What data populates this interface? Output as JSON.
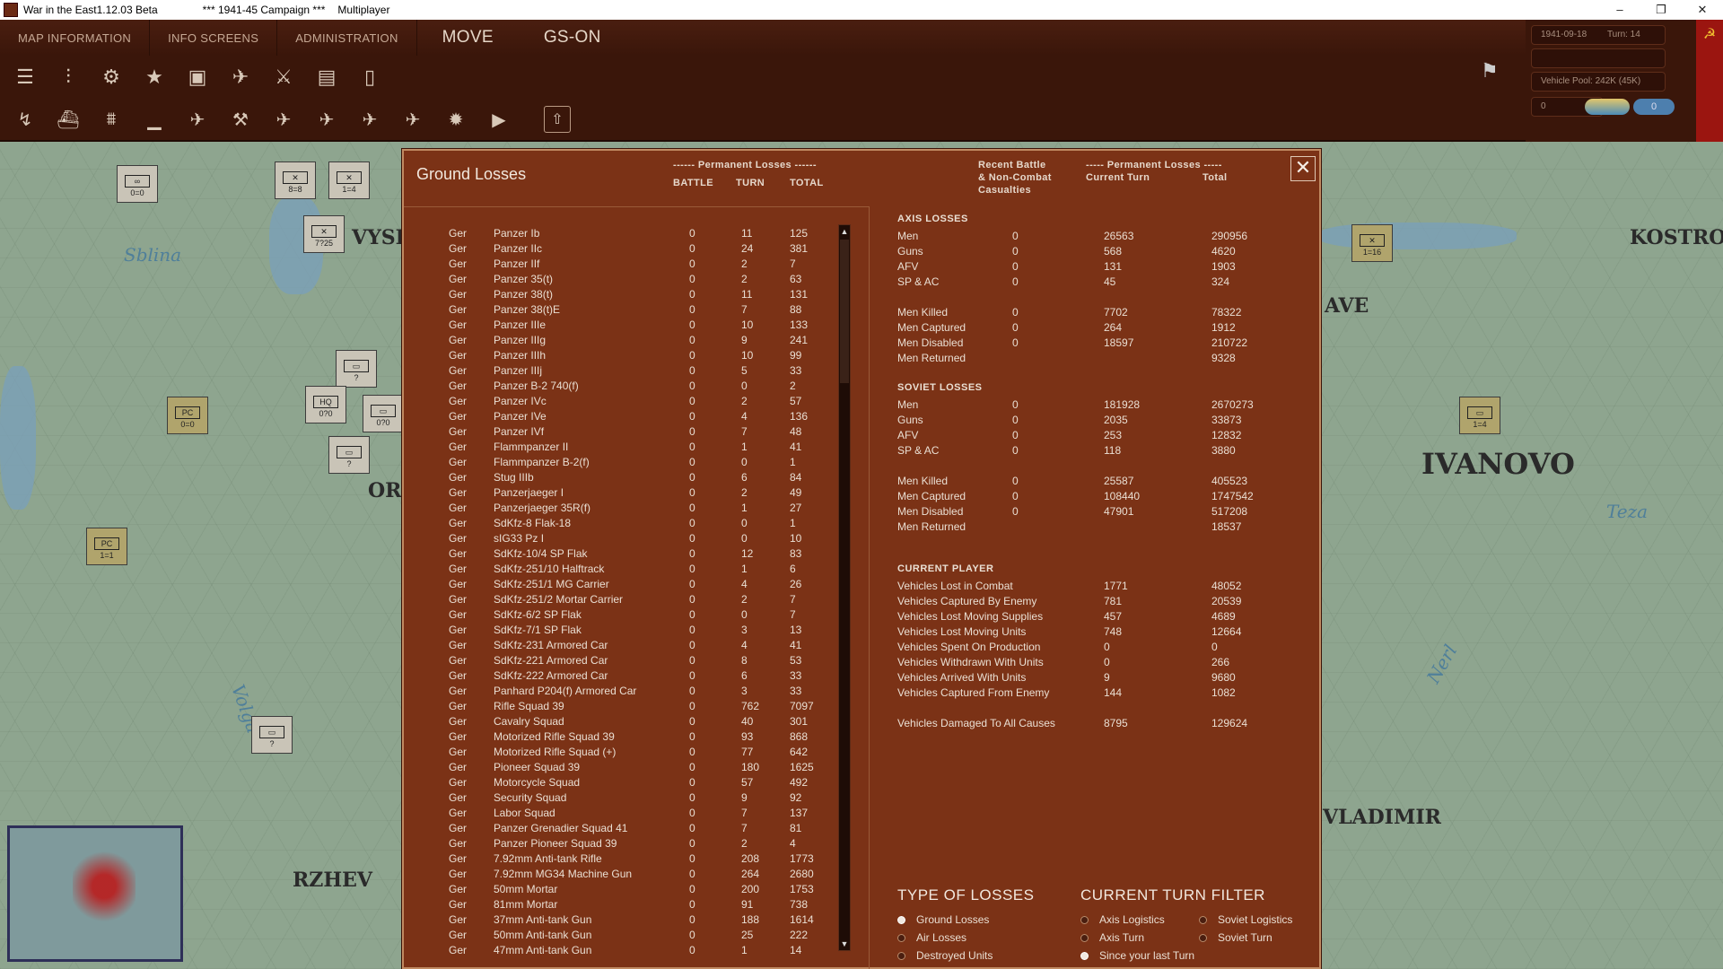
{
  "window": {
    "title": "War in the East1.12.03 Beta",
    "campaign": "***   1941-45 Campaign   ***",
    "mode": "Multiplayer",
    "controls": [
      "–",
      "❐",
      "✕"
    ]
  },
  "menu": {
    "tabs": [
      "MAP INFORMATION",
      "INFO SCREENS",
      "ADMINISTRATION"
    ],
    "phase": "MOVE",
    "gs": "GS-on"
  },
  "status": {
    "date": "1941-09-18",
    "turn": "Turn: 14",
    "vehicle_pool": "Vehicle Pool: 242K (45K)",
    "zero_value": "0",
    "pill_value": "0"
  },
  "map": {
    "labels": [
      "VYSH",
      "ORZ",
      "RZHEV",
      "KOSTRO",
      "IVANOVO",
      "VLADIMIR",
      "AVE"
    ],
    "rivers": [
      "Sblina",
      "Volga",
      "Teza",
      "Nerl"
    ],
    "units": [
      "0=0",
      "8=8",
      "1=4",
      "7?25",
      "?",
      "0?0",
      "0?0",
      "0=0",
      "?",
      "1=1",
      "?",
      "1=16",
      "1=4"
    ]
  },
  "dialog": {
    "title": "Ground Losses",
    "perm_header": "------ Permanent Losses ------",
    "col_battle": "BATTLE",
    "col_turn": "TURN",
    "col_total": "TOTAL",
    "recent_header": "Recent Battle\n& Non-Combat\nCasualties",
    "recent_l1": "Recent Battle",
    "recent_l2": "& Non-Combat",
    "recent_l3": "Casualties",
    "perm2_header": "----- Permanent Losses -----",
    "col_current": "Current Turn",
    "col_total2": "Total",
    "close": "✕"
  },
  "losses": [
    [
      "Ger",
      "Panzer Ib",
      "0",
      "11",
      "125"
    ],
    [
      "Ger",
      "Panzer IIc",
      "0",
      "24",
      "381"
    ],
    [
      "Ger",
      "Panzer IIf",
      "0",
      "2",
      "7"
    ],
    [
      "Ger",
      "Panzer 35(t)",
      "0",
      "2",
      "63"
    ],
    [
      "Ger",
      "Panzer 38(t)",
      "0",
      "11",
      "131"
    ],
    [
      "Ger",
      "Panzer 38(t)E",
      "0",
      "7",
      "88"
    ],
    [
      "Ger",
      "Panzer IIIe",
      "0",
      "10",
      "133"
    ],
    [
      "Ger",
      "Panzer IIIg",
      "0",
      "9",
      "241"
    ],
    [
      "Ger",
      "Panzer IIIh",
      "0",
      "10",
      "99"
    ],
    [
      "Ger",
      "Panzer IIIj",
      "0",
      "5",
      "33"
    ],
    [
      "Ger",
      "Panzer B-2 740(f)",
      "0",
      "0",
      "2"
    ],
    [
      "Ger",
      "Panzer IVc",
      "0",
      "2",
      "57"
    ],
    [
      "Ger",
      "Panzer IVe",
      "0",
      "4",
      "136"
    ],
    [
      "Ger",
      "Panzer IVf",
      "0",
      "7",
      "48"
    ],
    [
      "Ger",
      "Flammpanzer II",
      "0",
      "1",
      "41"
    ],
    [
      "Ger",
      "Flammpanzer B-2(f)",
      "0",
      "0",
      "1"
    ],
    [
      "Ger",
      "Stug IIIb",
      "0",
      "6",
      "84"
    ],
    [
      "Ger",
      "Panzerjaeger I",
      "0",
      "2",
      "49"
    ],
    [
      "Ger",
      "Panzerjaeger 35R(f)",
      "0",
      "1",
      "27"
    ],
    [
      "Ger",
      "SdKfz-8 Flak-18",
      "0",
      "0",
      "1"
    ],
    [
      "Ger",
      "sIG33 Pz I",
      "0",
      "0",
      "10"
    ],
    [
      "Ger",
      "SdKfz-10/4 SP Flak",
      "0",
      "12",
      "83"
    ],
    [
      "Ger",
      "SdKfz-251/10 Halftrack",
      "0",
      "1",
      "6"
    ],
    [
      "Ger",
      "SdKfz-251/1 MG Carrier",
      "0",
      "4",
      "26"
    ],
    [
      "Ger",
      "SdKfz-251/2 Mortar Carrier",
      "0",
      "2",
      "7"
    ],
    [
      "Ger",
      "SdKfz-6/2 SP Flak",
      "0",
      "0",
      "7"
    ],
    [
      "Ger",
      "SdKfz-7/1 SP Flak",
      "0",
      "3",
      "13"
    ],
    [
      "Ger",
      "SdKfz-231 Armored Car",
      "0",
      "4",
      "41"
    ],
    [
      "Ger",
      "SdKfz-221 Armored Car",
      "0",
      "8",
      "53"
    ],
    [
      "Ger",
      "SdKfz-222 Armored Car",
      "0",
      "6",
      "33"
    ],
    [
      "Ger",
      "Panhard P204(f) Armored Car",
      "0",
      "3",
      "33"
    ],
    [
      "Ger",
      "Rifle Squad 39",
      "0",
      "762",
      "7097"
    ],
    [
      "Ger",
      "Cavalry Squad",
      "0",
      "40",
      "301"
    ],
    [
      "Ger",
      "Motorized Rifle Squad 39",
      "0",
      "93",
      "868"
    ],
    [
      "Ger",
      "Motorized Rifle Squad (+)",
      "0",
      "77",
      "642"
    ],
    [
      "Ger",
      "Pioneer Squad 39",
      "0",
      "180",
      "1625"
    ],
    [
      "Ger",
      "Motorcycle Squad",
      "0",
      "57",
      "492"
    ],
    [
      "Ger",
      "Security Squad",
      "0",
      "9",
      "92"
    ],
    [
      "Ger",
      "Labor Squad",
      "0",
      "7",
      "137"
    ],
    [
      "Ger",
      "Panzer Grenadier Squad 41",
      "0",
      "7",
      "81"
    ],
    [
      "Ger",
      "Panzer Pioneer Squad 39",
      "0",
      "2",
      "4"
    ],
    [
      "Ger",
      "7.92mm Anti-tank Rifle",
      "0",
      "208",
      "1773"
    ],
    [
      "Ger",
      "7.92mm MG34 Machine Gun",
      "0",
      "264",
      "2680"
    ],
    [
      "Ger",
      "50mm Mortar",
      "0",
      "200",
      "1753"
    ],
    [
      "Ger",
      "81mm Mortar",
      "0",
      "91",
      "738"
    ],
    [
      "Ger",
      "37mm Anti-tank Gun",
      "0",
      "188",
      "1614"
    ],
    [
      "Ger",
      "50mm Anti-tank Gun",
      "0",
      "25",
      "222"
    ],
    [
      "Ger",
      "47mm Anti-tank Gun",
      "0",
      "1",
      "14"
    ]
  ],
  "axis": {
    "title": "AXIS LOSSES",
    "rows": [
      [
        "Men",
        "0",
        "26563",
        "290956"
      ],
      [
        "Guns",
        "0",
        "568",
        "4620"
      ],
      [
        "AFV",
        "0",
        "131",
        "1903"
      ],
      [
        "SP & AC",
        "0",
        "45",
        "324"
      ],
      [
        "Men Killed",
        "0",
        "7702",
        "78322"
      ],
      [
        "Men Captured",
        "0",
        "264",
        "1912"
      ],
      [
        "Men Disabled",
        "0",
        "18597",
        "210722"
      ],
      [
        "Men Returned",
        "",
        "",
        "9328"
      ]
    ]
  },
  "soviet": {
    "title": "SOVIET LOSSES",
    "rows": [
      [
        "Men",
        "0",
        "181928",
        "2670273"
      ],
      [
        "Guns",
        "0",
        "2035",
        "33873"
      ],
      [
        "AFV",
        "0",
        "253",
        "12832"
      ],
      [
        "SP & AC",
        "0",
        "118",
        "3880"
      ],
      [
        "Men Killed",
        "0",
        "25587",
        "405523"
      ],
      [
        "Men Captured",
        "0",
        "108440",
        "1747542"
      ],
      [
        "Men Disabled",
        "0",
        "47901",
        "517208"
      ],
      [
        "Men Returned",
        "",
        "",
        "18537"
      ]
    ]
  },
  "player": {
    "title": "CURRENT PLAYER",
    "rows": [
      [
        "Vehicles Lost in Combat",
        "1771",
        "48052"
      ],
      [
        "Vehicles Captured By Enemy",
        "781",
        "20539"
      ],
      [
        "Vehicles Lost Moving Supplies",
        "457",
        "4689"
      ],
      [
        "Vehicles Lost Moving Units",
        "748",
        "12664"
      ],
      [
        "Vehicles Spent On Production",
        "0",
        "0"
      ],
      [
        "Vehicles Withdrawn With Units",
        "0",
        "266"
      ],
      [
        "Vehicles Arrived With Units",
        "9",
        "9680"
      ],
      [
        "Vehicles Captured From Enemy",
        "144",
        "1082"
      ],
      [
        "Vehicles Damaged To All Causes",
        "8795",
        "129624"
      ]
    ]
  },
  "type_of_losses": {
    "title": "TYPE OF LOSSES",
    "options": [
      "Ground Losses",
      "Air Losses",
      "Destroyed Units"
    ],
    "selected": 0
  },
  "turn_filter": {
    "title": "CURRENT TURN FILTER",
    "options": [
      "Axis Logistics",
      "Soviet Logistics",
      "Axis Turn",
      "Soviet Turn",
      "Since your last Turn"
    ],
    "selected": 4
  },
  "icons": {
    "toolbar1": [
      "layers-icon",
      "bars-icon",
      "gear-icon",
      "star-icon",
      "hq-icon",
      "air-icon",
      "swords-icon",
      "train-icon",
      "fuel-icon"
    ],
    "toolbar2": [
      "unit-icon",
      "ship-icon",
      "boat-icon",
      "sub-icon",
      "plane-icon",
      "tank-icon",
      "fighter-icon",
      "bomber-icon",
      "transport-icon",
      "recon-icon",
      "explosion-icon",
      "play-icon",
      "upload-icon"
    ]
  }
}
